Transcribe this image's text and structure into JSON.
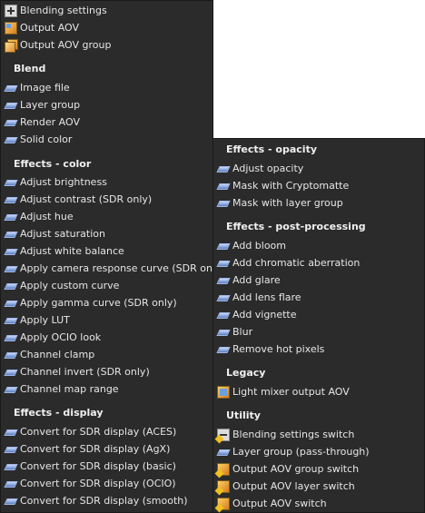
{
  "left_panel": {
    "top_items": [
      "Blending settings",
      "Output AOV",
      "Output AOV group"
    ],
    "blend": {
      "header": "Blend",
      "items": [
        "Image file",
        "Layer group",
        "Render AOV",
        "Solid color"
      ]
    },
    "color": {
      "header": "Effects - color",
      "items": [
        "Adjust brightness",
        "Adjust contrast (SDR only)",
        "Adjust hue",
        "Adjust saturation",
        "Adjust white balance",
        "Apply camera response curve (SDR only)",
        "Apply custom curve",
        "Apply gamma curve (SDR only)",
        "Apply LUT",
        "Apply OCIO look",
        "Channel clamp",
        "Channel invert (SDR only)",
        "Channel map range"
      ]
    },
    "display": {
      "header": "Effects - display",
      "items": [
        "Convert for SDR display (ACES)",
        "Convert for SDR display (AgX)",
        "Convert for SDR display (basic)",
        "Convert for SDR display (OCIO)",
        "Convert for SDR display (smooth)"
      ]
    }
  },
  "right_panel": {
    "opacity": {
      "header": "Effects - opacity",
      "items": [
        "Adjust opacity",
        "Mask with Cryptomatte",
        "Mask with layer group"
      ]
    },
    "post": {
      "header": "Effects - post-processing",
      "items": [
        "Add bloom",
        "Add chromatic aberration",
        "Add glare",
        "Add lens flare",
        "Add vignette",
        "Blur",
        "Remove hot pixels"
      ]
    },
    "legacy": {
      "header": "Legacy",
      "items": [
        "Light mixer output AOV"
      ]
    },
    "utility": {
      "header": "Utility",
      "items": [
        "Blending settings switch",
        "Layer group (pass-through)",
        "Output AOV group switch",
        "Output AOV layer switch",
        "Output AOV switch"
      ]
    }
  },
  "colors": {
    "panel_bg": "#2b2b2b",
    "text": "#e6e6e6",
    "page_bg": "#ffffff"
  }
}
